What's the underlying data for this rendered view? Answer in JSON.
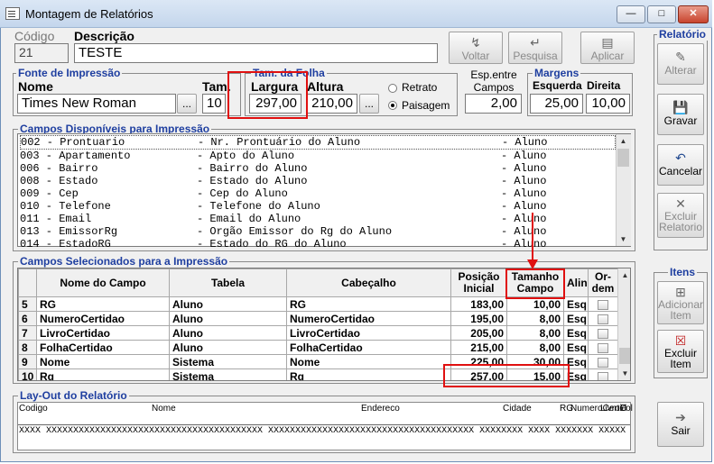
{
  "window": {
    "title": "Montagem de Relatórios"
  },
  "header": {
    "codigo_label": "Código",
    "codigo_value": "21",
    "descricao_label": "Descrição",
    "descricao_value": "TESTE",
    "voltar": "Voltar",
    "pesquisa": "Pesquisa",
    "aplicar": "Aplicar"
  },
  "fonte": {
    "title": "Fonte de Impressão",
    "nome_label": "Nome",
    "nome_value": "Times New Roman",
    "tam_label": "Tam.",
    "tam_value": "10",
    "dots": "..."
  },
  "folha": {
    "title": "Tam. da Folha",
    "largura_label": "Largura",
    "largura_value": "297,00",
    "altura_label": "Altura",
    "altura_value": "210,00",
    "dots": "...",
    "retrato": "Retrato",
    "paisagem": "Paisagem"
  },
  "espaco": {
    "label1": "Esp.entre",
    "label2": "Campos",
    "value": "2,00"
  },
  "margens": {
    "title": "Margens",
    "esquerda_label": "Esquerda",
    "esquerda_value": "25,00",
    "direita_label": "Direita",
    "direita_value": "10,00"
  },
  "relatorio": {
    "title": "Relatório",
    "alterar": "Alterar",
    "gravar": "Gravar",
    "cancelar": "Cancelar",
    "excluir1": "Excluir",
    "excluir2": "Relatorio"
  },
  "disponiveis": {
    "title": "Campos Disponíveis para Impressão",
    "rows": [
      {
        "code": "002 - Prontuario",
        "desc": "- Nr. Prontuário do Aluno",
        "tab": "- Aluno"
      },
      {
        "code": "003 - Apartamento",
        "desc": "- Apto do Aluno",
        "tab": "- Aluno"
      },
      {
        "code": "006 - Bairro",
        "desc": "- Bairro do Aluno",
        "tab": "- Aluno"
      },
      {
        "code": "008 - Estado",
        "desc": "- Estado do Aluno",
        "tab": "- Aluno"
      },
      {
        "code": "009 - Cep",
        "desc": "- Cep do Aluno",
        "tab": "- Aluno"
      },
      {
        "code": "010 - Telefone",
        "desc": "- Telefone do Aluno",
        "tab": "- Aluno"
      },
      {
        "code": "011 - Email",
        "desc": "- Email do Aluno",
        "tab": "- Aluno"
      },
      {
        "code": "013 - EmissorRg",
        "desc": "- Orgão Emissor do Rg do Aluno",
        "tab": "- Aluno"
      },
      {
        "code": "014 - EstadoRG",
        "desc": "- Estado do RG do Aluno",
        "tab": "- Aluno"
      }
    ]
  },
  "selecionados": {
    "title": "Campos Selecionados para a Impressão",
    "headers": {
      "nome": "Nome do Campo",
      "tabela": "Tabela",
      "cabecalho": "Cabeçalho",
      "pos1": "Posição",
      "pos2": "Inicial",
      "tam1": "Tamanho",
      "tam2": "Campo",
      "alin": "Alin",
      "ord1": "Or-",
      "ord2": "dem"
    },
    "rows": [
      {
        "n": "5",
        "nome": "RG",
        "tabela": "Aluno",
        "cab": "RG",
        "pos": "183,00",
        "tam": "10,00",
        "alin": "Esq"
      },
      {
        "n": "6",
        "nome": "NumeroCertidao",
        "tabela": "Aluno",
        "cab": "NumeroCertidao",
        "pos": "195,00",
        "tam": "8,00",
        "alin": "Esq"
      },
      {
        "n": "7",
        "nome": "LivroCertidao",
        "tabela": "Aluno",
        "cab": "LivroCertidao",
        "pos": "205,00",
        "tam": "8,00",
        "alin": "Esq"
      },
      {
        "n": "8",
        "nome": "FolhaCertidao",
        "tabela": "Aluno",
        "cab": "FolhaCertidao",
        "pos": "215,00",
        "tam": "8,00",
        "alin": "Esq"
      },
      {
        "n": "9",
        "nome": "Nome",
        "tabela": "Sistema",
        "cab": "Nome",
        "pos": "225,00",
        "tam": "30,00",
        "alin": "Esq"
      },
      {
        "n": "10",
        "nome": "Rg",
        "tabela": "Sistema",
        "cab": "Rg",
        "pos": "257,00",
        "tam": "15,00",
        "alin": "Esq"
      }
    ]
  },
  "itens": {
    "title": "Itens",
    "adicionar1": "Adicionar",
    "adicionar2": "Item",
    "excluir1": "Excluir",
    "excluir2": "Item"
  },
  "layout": {
    "title": "Lay-Out do Relatório",
    "cols": [
      "Codigo",
      "Nome",
      "Endereco",
      "Cidade",
      "RG",
      "NumeroCertid",
      "LivroC",
      "Fol"
    ],
    "fill": "XXXX XXXXXXXXXXXXXXXXXXXXXXXXXXXXXXXXXXXXXXXX XXXXXXXXXXXXXXXXXXXXXXXXXXXXXXXXXXXXXX XXXXXXXX XXXX XXXXXXX XXXXX XXXX XX"
  },
  "sair": "Sair"
}
